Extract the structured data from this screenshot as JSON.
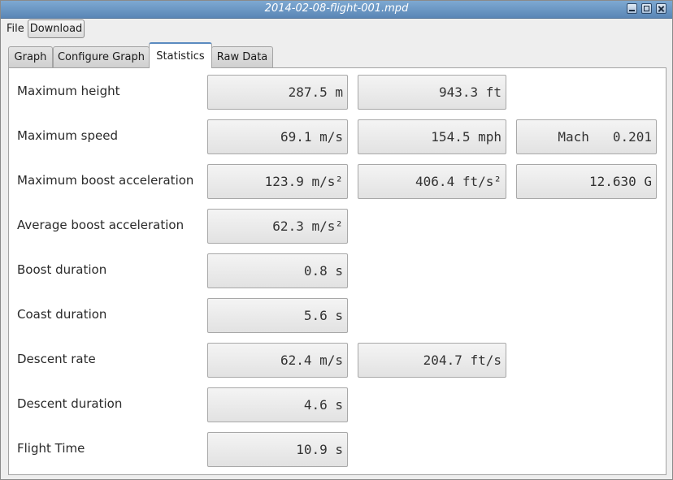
{
  "window": {
    "title": "2014-02-08-flight-001.mpd"
  },
  "menubar": {
    "file": "File",
    "download": "Download"
  },
  "tabs": [
    "Graph",
    "Configure Graph",
    "Statistics",
    "Raw Data"
  ],
  "stats": {
    "max_height": {
      "label": "Maximum height",
      "m": "287.5 m",
      "ft": "943.3 ft"
    },
    "max_speed": {
      "label": "Maximum speed",
      "ms": "69.1 m/s",
      "mph": "154.5 mph",
      "mach": "Mach   0.201"
    },
    "max_boost_accel": {
      "label": "Maximum boost acceleration",
      "ms2": "123.9 m/s²",
      "fts2": "406.4 ft/s²",
      "g": "12.630 G"
    },
    "avg_boost_accel": {
      "label": "Average boost acceleration",
      "ms2": "62.3 m/s²"
    },
    "boost_duration": {
      "label": "Boost duration",
      "s": "0.8 s"
    },
    "coast_duration": {
      "label": "Coast duration",
      "s": "5.6 s"
    },
    "descent_rate": {
      "label": "Descent rate",
      "ms": "62.4 m/s",
      "fts": "204.7 ft/s"
    },
    "descent_duration": {
      "label": "Descent duration",
      "s": "4.6 s"
    },
    "flight_time": {
      "label": "Flight Time",
      "s": "10.9 s"
    }
  }
}
